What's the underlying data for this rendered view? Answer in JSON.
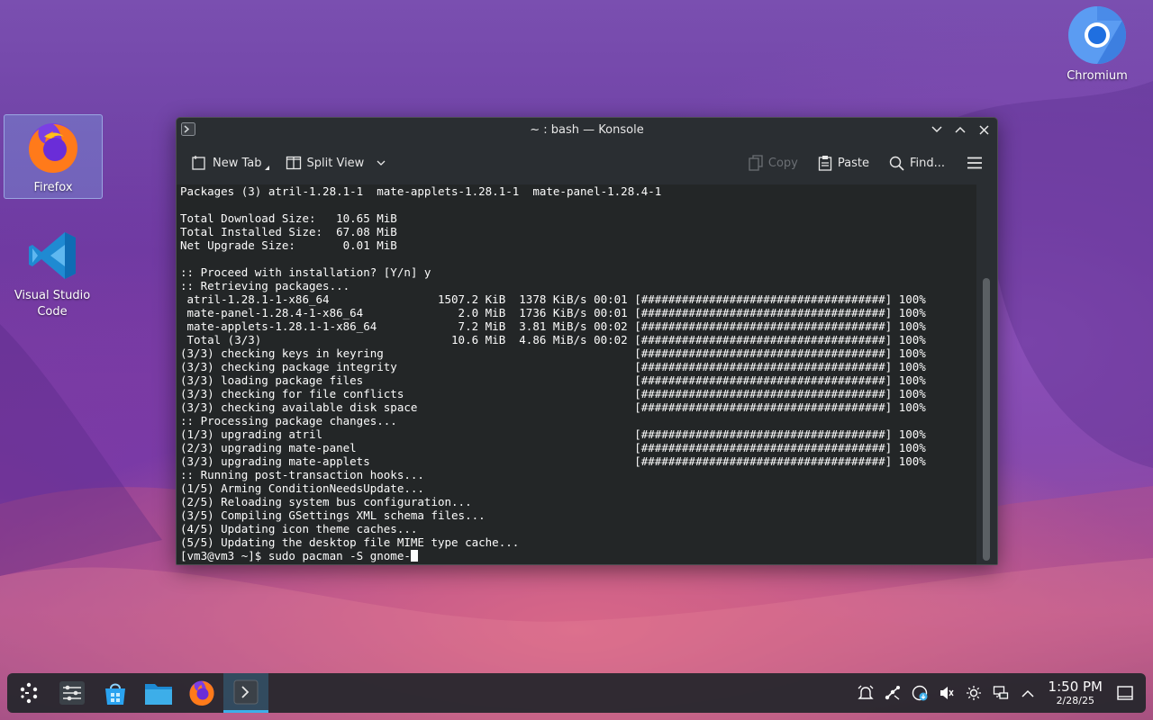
{
  "desktop": {
    "icons": [
      {
        "label": "Firefox"
      },
      {
        "label": "Visual Studio Code"
      },
      {
        "label": "Chromium"
      }
    ]
  },
  "window": {
    "title": "~ : bash — Konsole",
    "toolbar": {
      "new_tab": "New Tab",
      "split_view": "Split View",
      "copy": "Copy",
      "paste": "Paste",
      "find": "Find..."
    }
  },
  "terminal": {
    "lines": [
      "Packages (3) atril-1.28.1-1  mate-applets-1.28.1-1  mate-panel-1.28.4-1",
      "",
      "Total Download Size:   10.65 MiB",
      "Total Installed Size:  67.08 MiB",
      "Net Upgrade Size:       0.01 MiB",
      "",
      ":: Proceed with installation? [Y/n] y",
      ":: Retrieving packages...",
      " atril-1.28.1-1-x86_64                1507.2 KiB  1378 KiB/s 00:01 [####################################] 100%",
      " mate-panel-1.28.4-1-x86_64              2.0 MiB  1736 KiB/s 00:01 [####################################] 100%",
      " mate-applets-1.28.1-1-x86_64            7.2 MiB  3.81 MiB/s 00:02 [####################################] 100%",
      " Total (3/3)                            10.6 MiB  4.86 MiB/s 00:02 [####################################] 100%",
      "(3/3) checking keys in keyring                                     [####################################] 100%",
      "(3/3) checking package integrity                                   [####################################] 100%",
      "(3/3) loading package files                                        [####################################] 100%",
      "(3/3) checking for file conflicts                                  [####################################] 100%",
      "(3/3) checking available disk space                                [####################################] 100%",
      ":: Processing package changes...",
      "(1/3) upgrading atril                                              [####################################] 100%",
      "(2/3) upgrading mate-panel                                         [####################################] 100%",
      "(3/3) upgrading mate-applets                                       [####################################] 100%",
      ":: Running post-transaction hooks...",
      "(1/5) Arming ConditionNeedsUpdate...",
      "(2/5) Reloading system bus configuration...",
      "(3/5) Compiling GSettings XML schema files...",
      "(4/5) Updating icon theme caches...",
      "(5/5) Updating the desktop file MIME type cache..."
    ],
    "prompt": "[vm3@vm3 ~]$ ",
    "input": "sudo pacman -S gnome-"
  },
  "taskbar": {
    "clock_time": "1:50 PM",
    "clock_date": "2/28/25"
  },
  "colors": {
    "accent": "#3daee9",
    "terminal_bg": "#232627",
    "window_bg": "#2a2e32"
  }
}
